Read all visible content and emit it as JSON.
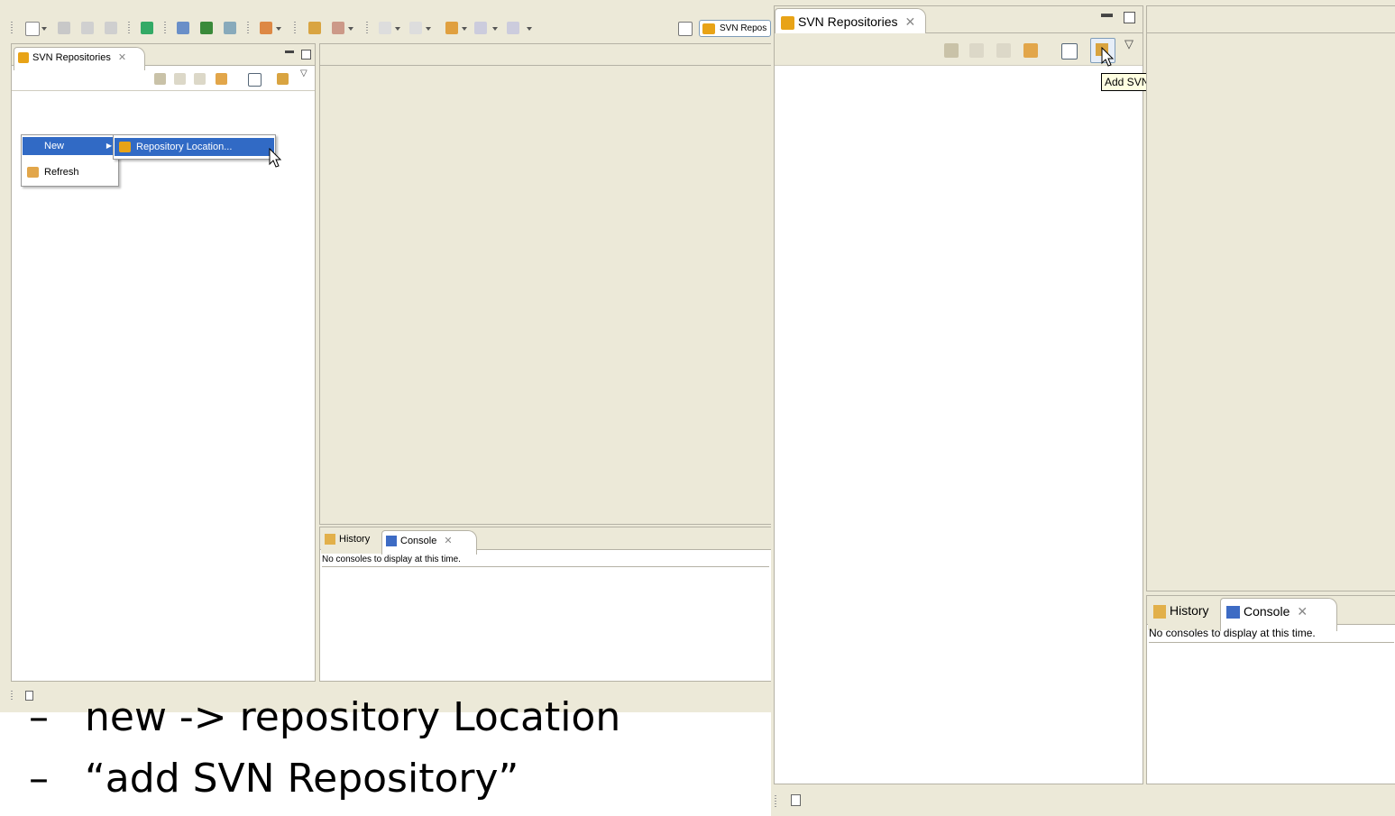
{
  "left_screen": {
    "perspective_button": "SVN Repos",
    "repos_view": {
      "tab_title": "SVN Repositories",
      "context_menu": {
        "items": [
          {
            "label": "New"
          },
          {
            "label": "Refresh"
          }
        ],
        "submenu_item": "Repository Location..."
      }
    },
    "bottom_view": {
      "tabs": [
        "History",
        "Console"
      ],
      "console_message": "No consoles to display at this time."
    }
  },
  "right_screen": {
    "repos_view": {
      "tab_title": "SVN Repositories",
      "tooltip": "Add SVN Repository"
    },
    "bottom_view": {
      "tabs": [
        "History",
        "Console"
      ],
      "console_message": "No consoles to display at this time."
    }
  },
  "bullets": [
    {
      "dash": "–",
      "text": "new -> repository Location"
    },
    {
      "dash": "–",
      "text": "“add SVN Repository”"
    }
  ],
  "icons": [
    "svn-repo-icon",
    "home-icon",
    "back-arrow-icon",
    "forward-arrow-icon",
    "refresh-icon",
    "collapse-all-icon",
    "add-repository-icon",
    "view-menu-icon",
    "history-icon",
    "console-icon",
    "close-icon",
    "minimize-icon",
    "maximize-icon",
    "new-wizard-icon"
  ],
  "colors": {
    "eclipse_bg": "#ece9d8",
    "selection": "#316ac5",
    "tooltip_bg": "#ffffe1",
    "svn_icon": "#e8a317"
  }
}
